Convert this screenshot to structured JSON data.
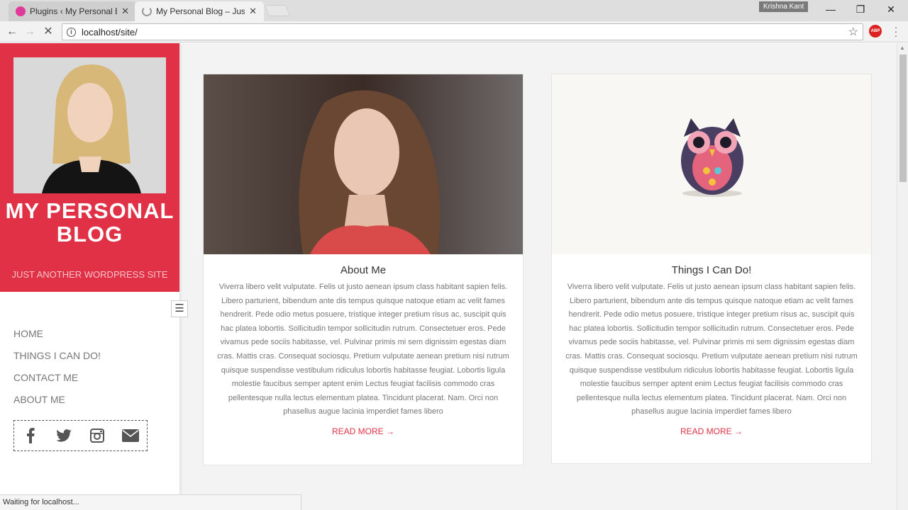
{
  "browser": {
    "tabs": [
      {
        "label": "Plugins ‹ My Personal Blo"
      },
      {
        "label": "My Personal Blog – Just a"
      }
    ],
    "profile": "Krishna Kant",
    "url": "localhost/site/",
    "status": "Waiting for localhost..."
  },
  "sidebar": {
    "site_title": "MY PERSONAL BLOG",
    "site_description": "JUST ANOTHER WORDPRESS SITE",
    "nav": [
      {
        "label": "HOME"
      },
      {
        "label": "THINGS I CAN DO!"
      },
      {
        "label": "CONTACT ME"
      },
      {
        "label": "ABOUT ME"
      }
    ],
    "social_icons": [
      "facebook-icon",
      "twitter-icon",
      "instagram-icon",
      "envelope-icon"
    ]
  },
  "cards": [
    {
      "title": "About Me",
      "text": "Viverra libero velit vulputate. Felis ut justo aenean ipsum class habitant sapien felis. Libero parturient, bibendum ante dis tempus quisque natoque etiam ac velit fames hendrerit. Pede odio metus posuere, tristique integer pretium risus ac, suscipit quis hac platea lobortis. Sollicitudin tempor sollicitudin rutrum. Consectetuer eros. Pede vivamus pede sociis habitasse, vel. Pulvinar primis mi sem dignissim egestas diam cras. Mattis cras. Consequat sociosqu. Pretium vulputate aenean pretium nisi rutrum quisque suspendisse vestibulum ridiculus lobortis habitasse feugiat. Lobortis ligula molestie faucibus semper aptent enim Lectus feugiat facilisis commodo cras pellentesque nulla lectus elementum platea. Tincidunt placerat. Nam. Orci non phasellus augue lacinia imperdiet fames libero",
      "read_more": "READ MORE →"
    },
    {
      "title": "Things I Can Do!",
      "text": "Viverra libero velit vulputate. Felis ut justo aenean ipsum class habitant sapien felis. Libero parturient, bibendum ante dis tempus quisque natoque etiam ac velit fames hendrerit. Pede odio metus posuere, tristique integer pretium risus ac, suscipit quis hac platea lobortis. Sollicitudin tempor sollicitudin rutrum. Consectetuer eros. Pede vivamus pede sociis habitasse, vel. Pulvinar primis mi sem dignissim egestas diam cras. Mattis cras. Consequat sociosqu. Pretium vulputate aenean pretium nisi rutrum quisque suspendisse vestibulum ridiculus lobortis habitasse feugiat. Lobortis ligula molestie faucibus semper aptent enim Lectus feugiat facilisis commodo cras pellentesque nulla lectus elementum platea. Tincidunt placerat. Nam. Orci non phasellus augue lacinia imperdiet fames libero",
      "read_more": "READ MORE →"
    }
  ],
  "colors": {
    "accent": "#e03146",
    "background": "#f3f3f3"
  }
}
